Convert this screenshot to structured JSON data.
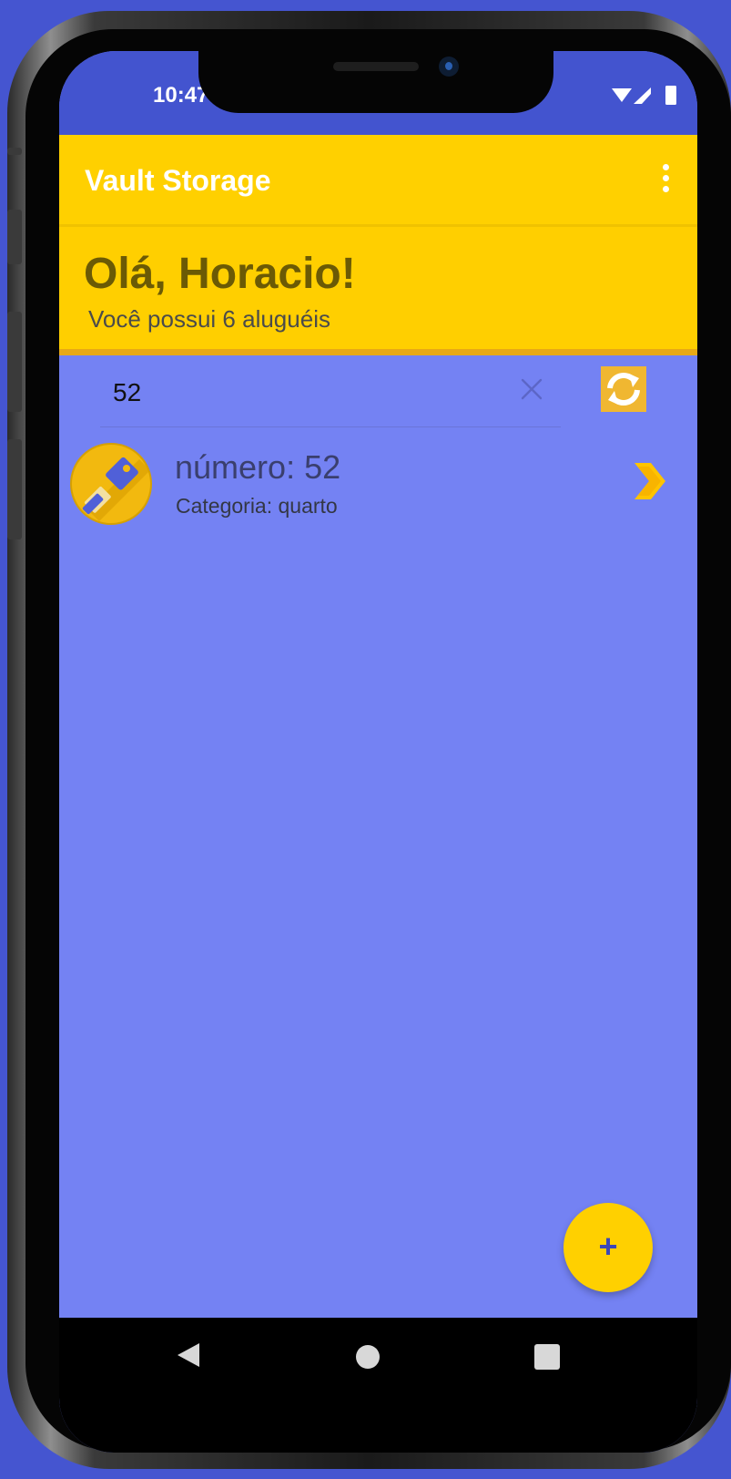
{
  "status_bar": {
    "time": "10:47",
    "icons": [
      "wifi-icon",
      "signal-icon",
      "battery-icon"
    ]
  },
  "app_bar": {
    "title": "Vault Storage",
    "menu_icon": "more-vert-icon"
  },
  "greeting": {
    "title": "Olá, Horacio!",
    "subtitle": "Você possui 6 aluguéis"
  },
  "search": {
    "value": "52",
    "clear_icon": "close-icon",
    "refresh_icon": "refresh-icon"
  },
  "results": [
    {
      "title": "número: 52",
      "subtitle": "Categoria: quarto",
      "icon": "key-icon",
      "action_icon": "chevron-right-icon"
    }
  ],
  "fab": {
    "label": "+"
  },
  "navigation": {
    "back_icon": "back-triangle-icon",
    "home_icon": "home-circle-icon",
    "recents_icon": "recents-square-icon"
  },
  "colors": {
    "background": "#4555d0",
    "status_bar": "#4354cf",
    "app_bar": "#ffd000",
    "greeting_panel": "#ffcf00",
    "list_background": "#7482f3",
    "accent": "#ffd000",
    "refresh_button": "#f0b731"
  }
}
